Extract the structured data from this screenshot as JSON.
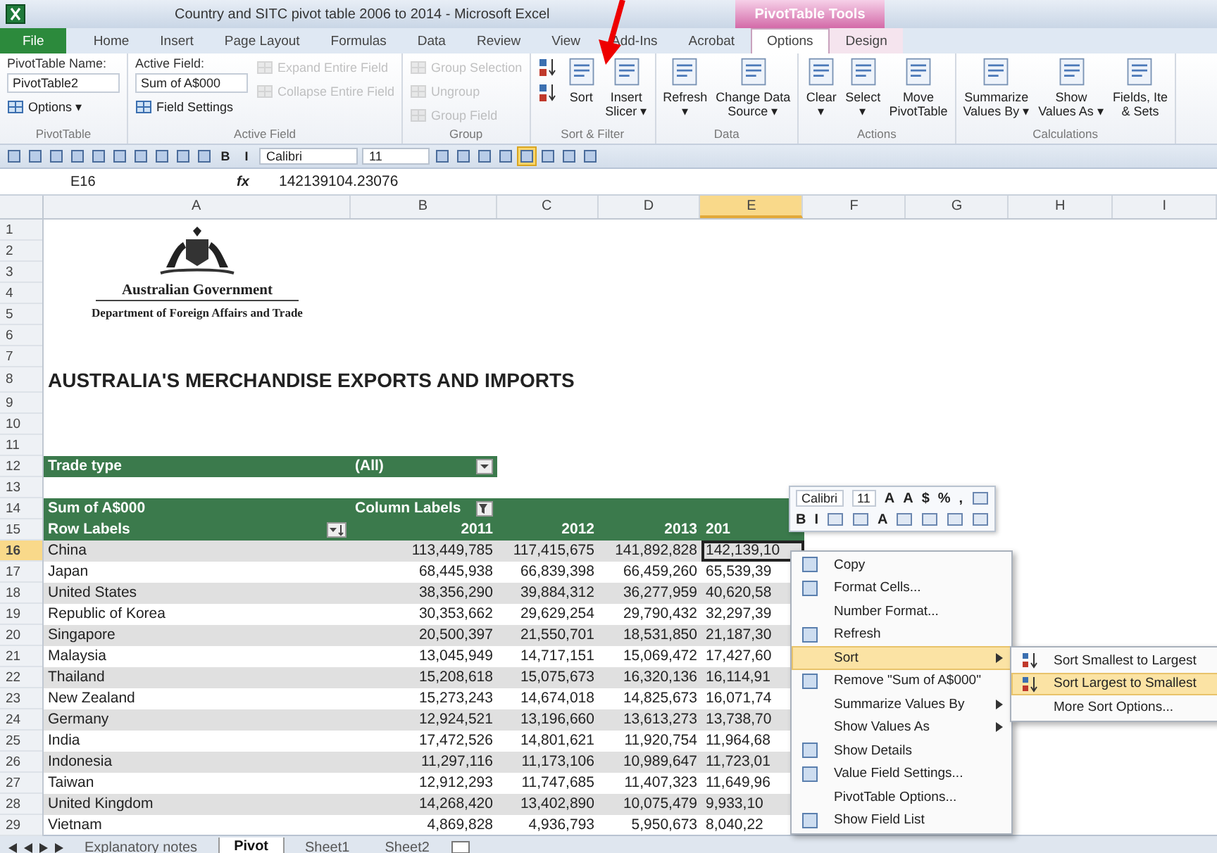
{
  "window": {
    "title": "Country and SITC pivot table 2006 to 2014 - Microsoft Excel"
  },
  "contextual_tab_group": "PivotTable Tools",
  "ribbon_tabs": [
    {
      "label": "File",
      "kind": "file",
      "selected": false
    },
    {
      "label": "Home",
      "kind": "tab",
      "selected": false
    },
    {
      "label": "Insert",
      "kind": "tab",
      "selected": false
    },
    {
      "label": "Page Layout",
      "kind": "tab",
      "selected": false
    },
    {
      "label": "Formulas",
      "kind": "tab",
      "selected": false
    },
    {
      "label": "Data",
      "kind": "tab",
      "selected": false
    },
    {
      "label": "Review",
      "kind": "tab",
      "selected": false
    },
    {
      "label": "View",
      "kind": "tab",
      "selected": false
    },
    {
      "label": "Add-Ins",
      "kind": "tab",
      "selected": false
    },
    {
      "label": "Acrobat",
      "kind": "tab",
      "selected": false
    },
    {
      "label": "Options",
      "kind": "context",
      "selected": true
    },
    {
      "label": "Design",
      "kind": "context",
      "selected": false
    }
  ],
  "ribbon_groups": [
    {
      "label": "PivotTable",
      "columns": [
        [
          {
            "kind": "text",
            "label": "PivotTable Name:"
          },
          {
            "kind": "input",
            "value": "PivotTable2"
          },
          {
            "kind": "small",
            "label": "Options ▾",
            "disabled": false
          }
        ]
      ]
    },
    {
      "label": "Active Field",
      "columns": [
        [
          {
            "kind": "text",
            "label": "Active Field:"
          },
          {
            "kind": "input",
            "value": "Sum of A$000"
          },
          {
            "kind": "small",
            "label": "Field Settings",
            "disabled": false
          }
        ],
        [
          {
            "kind": "small",
            "label": "Expand Entire Field",
            "disabled": true
          },
          {
            "kind": "small",
            "label": "Collapse Entire Field",
            "disabled": true
          }
        ]
      ]
    },
    {
      "label": "Group",
      "columns": [
        [
          {
            "kind": "small",
            "label": "Group Selection",
            "disabled": true
          },
          {
            "kind": "small",
            "label": "Ungroup",
            "disabled": true
          },
          {
            "kind": "small",
            "label": "Group Field",
            "disabled": true
          }
        ]
      ]
    },
    {
      "label": "Sort & Filter",
      "columns": [
        [
          {
            "kind": "icon",
            "disabled": false
          },
          {
            "kind": "icon",
            "disabled": false
          }
        ],
        [
          {
            "kind": "large",
            "label": "Sort",
            "disabled": false
          }
        ],
        [
          {
            "kind": "large",
            "label": "Insert\nSlicer ▾",
            "disabled": false
          }
        ]
      ]
    },
    {
      "label": "Data",
      "columns": [
        [
          {
            "kind": "large",
            "label": "Refresh\n▾",
            "disabled": false
          }
        ],
        [
          {
            "kind": "large",
            "label": "Change Data\nSource ▾",
            "disabled": false
          }
        ]
      ]
    },
    {
      "label": "Actions",
      "columns": [
        [
          {
            "kind": "large",
            "label": "Clear\n▾",
            "disabled": false
          }
        ],
        [
          {
            "kind": "large",
            "label": "Select\n▾",
            "disabled": false
          }
        ],
        [
          {
            "kind": "large",
            "label": "Move\nPivotTable",
            "disabled": false
          }
        ]
      ]
    },
    {
      "label": "Calculations",
      "columns": [
        [
          {
            "kind": "large",
            "label": "Summarize\nValues By ▾",
            "disabled": false
          }
        ],
        [
          {
            "kind": "large",
            "label": "Show\nValues As ▾",
            "disabled": false
          }
        ],
        [
          {
            "kind": "large",
            "label": "Fields, Ite\n& Sets",
            "disabled": false
          }
        ]
      ]
    }
  ],
  "quick_access": [
    {
      "kind": "icon",
      "on": false
    },
    {
      "kind": "icon",
      "on": false
    },
    {
      "kind": "icon",
      "on": false
    },
    {
      "kind": "icon",
      "on": false
    },
    {
      "kind": "icon",
      "on": false
    },
    {
      "kind": "icon",
      "on": false
    },
    {
      "kind": "icon",
      "on": false
    },
    {
      "kind": "icon",
      "on": false
    },
    {
      "kind": "icon",
      "on": false
    },
    {
      "kind": "icon",
      "on": false
    },
    {
      "kind": "glyph",
      "label": "B",
      "on": false
    },
    {
      "kind": "glyph",
      "label": "I",
      "on": false
    },
    {
      "kind": "field",
      "label": "Calibri",
      "on": false
    },
    {
      "kind": "field",
      "label": "11",
      "on": false
    },
    {
      "kind": "icon",
      "on": false
    },
    {
      "kind": "icon",
      "on": false
    },
    {
      "kind": "icon",
      "on": false
    },
    {
      "kind": "icon",
      "on": false
    },
    {
      "kind": "icon",
      "on": true
    },
    {
      "kind": "icon",
      "on": false
    },
    {
      "kind": "icon",
      "on": false
    },
    {
      "kind": "icon",
      "on": false
    }
  ],
  "formula_bar": {
    "name_box": "E16",
    "function_label": "fx",
    "value": "142139104.23076"
  },
  "columns": [
    {
      "label": "A",
      "selected": false
    },
    {
      "label": "B",
      "selected": false
    },
    {
      "label": "C",
      "selected": false
    },
    {
      "label": "D",
      "selected": false
    },
    {
      "label": "E",
      "selected": true
    },
    {
      "label": "F",
      "selected": false
    },
    {
      "label": "G",
      "selected": false
    },
    {
      "label": "H",
      "selected": false
    },
    {
      "label": "I",
      "selected": false
    }
  ],
  "row_numbers": [
    "1",
    "2",
    "3",
    "4",
    "5",
    "6",
    "7",
    "8",
    "9",
    "10",
    "11",
    "12",
    "13",
    "14",
    "15",
    "16",
    "17",
    "18",
    "19",
    "20",
    "21",
    "22",
    "23",
    "24",
    "25",
    "26",
    "27",
    "28",
    "29"
  ],
  "logo": {
    "title": "Australian Government",
    "subtitle": "Department of Foreign Affairs and Trade"
  },
  "heading": "AUSTRALIA'S MERCHANDISE EXPORTS AND IMPORTS",
  "report_filter": {
    "label": "Trade type",
    "value": "(All)"
  },
  "pivot": {
    "value_field": "Sum of A$000",
    "column_labels": "Column Labels",
    "row_labels": "Row Labels",
    "years": [
      "2011",
      "2012",
      "2013",
      "201"
    ],
    "rows": [
      {
        "label": "China",
        "values": [
          "113,449,785",
          "117,415,675",
          "141,892,828",
          "142,139,10"
        ],
        "selected": true
      },
      {
        "label": "Japan",
        "values": [
          "68,445,938",
          "66,839,398",
          "66,459,260",
          "65,539,39"
        ],
        "selected": false
      },
      {
        "label": "United States",
        "values": [
          "38,356,290",
          "39,884,312",
          "36,277,959",
          "40,620,58"
        ],
        "selected": false
      },
      {
        "label": "Republic of Korea",
        "values": [
          "30,353,662",
          "29,629,254",
          "29,790,432",
          "32,297,39"
        ],
        "selected": false
      },
      {
        "label": "Singapore",
        "values": [
          "20,500,397",
          "21,550,701",
          "18,531,850",
          "21,187,30"
        ],
        "selected": false
      },
      {
        "label": "Malaysia",
        "values": [
          "13,045,949",
          "14,717,151",
          "15,069,472",
          "17,427,60"
        ],
        "selected": false
      },
      {
        "label": "Thailand",
        "values": [
          "15,208,618",
          "15,075,673",
          "16,320,136",
          "16,114,91"
        ],
        "selected": false
      },
      {
        "label": "New Zealand",
        "values": [
          "15,273,243",
          "14,674,018",
          "14,825,673",
          "16,071,74"
        ],
        "selected": false
      },
      {
        "label": "Germany",
        "values": [
          "12,924,521",
          "13,196,660",
          "13,613,273",
          "13,738,70"
        ],
        "selected": false
      },
      {
        "label": "India",
        "values": [
          "17,472,526",
          "14,801,621",
          "11,920,754",
          "11,964,68"
        ],
        "selected": false
      },
      {
        "label": "Indonesia",
        "values": [
          "11,297,116",
          "11,173,106",
          "10,989,647",
          "11,723,01"
        ],
        "selected": false
      },
      {
        "label": "Taiwan",
        "values": [
          "12,912,293",
          "11,747,685",
          "11,407,323",
          "11,649,96"
        ],
        "selected": false
      },
      {
        "label": "United Kingdom",
        "values": [
          "14,268,420",
          "13,402,890",
          "10,075,479",
          "9,933,10"
        ],
        "selected": false
      },
      {
        "label": "Vietnam",
        "values": [
          "4,869,828",
          "4,936,793",
          "5,950,673",
          "8,040,22"
        ],
        "selected": false
      }
    ]
  },
  "mini_toolbar": {
    "font_controls": [
      {
        "kind": "field",
        "label": "Calibri"
      },
      {
        "kind": "field",
        "label": "11"
      },
      {
        "kind": "glyph",
        "label": "A"
      },
      {
        "kind": "glyph",
        "label": "A"
      },
      {
        "kind": "glyph",
        "label": "$"
      },
      {
        "kind": "glyph",
        "label": "%"
      },
      {
        "kind": "glyph",
        "label": ","
      },
      {
        "kind": "icon"
      }
    ],
    "format_controls": [
      {
        "kind": "glyph",
        "label": "B"
      },
      {
        "kind": "glyph",
        "label": "I"
      },
      {
        "kind": "icon"
      },
      {
        "kind": "icon"
      },
      {
        "kind": "glyph",
        "label": "A"
      },
      {
        "kind": "icon"
      },
      {
        "kind": "icon"
      },
      {
        "kind": "icon"
      },
      {
        "kind": "icon"
      }
    ]
  },
  "context_menu": [
    {
      "label": "Copy",
      "has_icon": true,
      "submenu": false,
      "selected": false
    },
    {
      "label": "Format Cells...",
      "has_icon": true,
      "submenu": false,
      "selected": false
    },
    {
      "label": "Number Format...",
      "has_icon": false,
      "submenu": false,
      "selected": false
    },
    {
      "label": "Refresh",
      "has_icon": true,
      "submenu": false,
      "selected": false
    },
    {
      "label": "Sort",
      "has_icon": false,
      "submenu": true,
      "selected": true
    },
    {
      "label": "Remove \"Sum of A$000\"",
      "has_icon": true,
      "submenu": false,
      "selected": false
    },
    {
      "label": "Summarize Values By",
      "has_icon": false,
      "submenu": true,
      "selected": false
    },
    {
      "label": "Show Values As",
      "has_icon": false,
      "submenu": true,
      "selected": false
    },
    {
      "label": "Show Details",
      "has_icon": true,
      "submenu": false,
      "selected": false
    },
    {
      "label": "Value Field Settings...",
      "has_icon": true,
      "submenu": false,
      "selected": false
    },
    {
      "label": "PivotTable Options...",
      "has_icon": false,
      "submenu": false,
      "selected": false
    },
    {
      "label": "Show Field List",
      "has_icon": true,
      "submenu": false,
      "selected": false
    }
  ],
  "sort_submenu": [
    {
      "label": "Sort Smallest to Largest",
      "has_icon": true,
      "selected": false
    },
    {
      "label": "Sort Largest to Smallest",
      "has_icon": true,
      "selected": true
    },
    {
      "label": "More Sort Options...",
      "has_icon": false,
      "selected": false
    }
  ],
  "sheet_tabs": [
    {
      "label": "Explanatory notes",
      "selected": false
    },
    {
      "label": "Pivot",
      "selected": true
    },
    {
      "label": "Sheet1",
      "selected": false
    },
    {
      "label": "Sheet2",
      "selected": false
    }
  ]
}
